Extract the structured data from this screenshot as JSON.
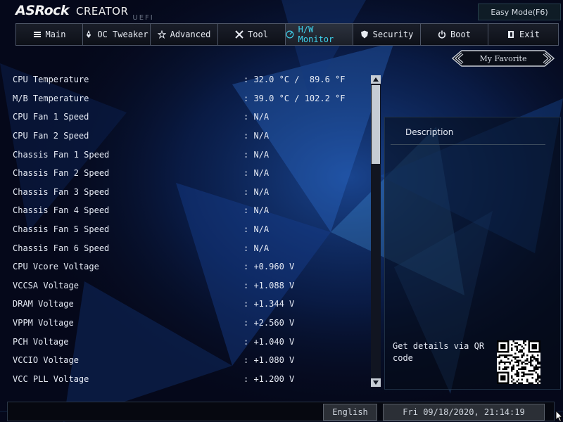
{
  "brand": {
    "logo": "ASRock",
    "line": "CREATOR",
    "uefi": "UEFI"
  },
  "easy_mode_label": "Easy Mode(F6)",
  "tabs": [
    {
      "label": "Main",
      "icon": "list-icon",
      "active": false
    },
    {
      "label": "OC Tweaker",
      "icon": "rocket-icon",
      "active": false
    },
    {
      "label": "Advanced",
      "icon": "star-icon",
      "active": false
    },
    {
      "label": "Tool",
      "icon": "tools-icon",
      "active": false
    },
    {
      "label": "H/W Monitor",
      "icon": "monitor-icon",
      "active": true
    },
    {
      "label": "Security",
      "icon": "shield-icon",
      "active": false
    },
    {
      "label": "Boot",
      "icon": "power-icon",
      "active": false
    },
    {
      "label": "Exit",
      "icon": "exit-icon",
      "active": false
    }
  ],
  "favorite_label": "My Favorite",
  "monitor": [
    {
      "label": "CPU Temperature",
      "value": ": 32.0 °C /  89.6 °F"
    },
    {
      "label": "M/B Temperature",
      "value": ": 39.0 °C / 102.2 °F"
    },
    {
      "label": "CPU Fan 1 Speed",
      "value": ": N/A"
    },
    {
      "label": "CPU Fan 2 Speed",
      "value": ": N/A"
    },
    {
      "label": "Chassis Fan 1 Speed",
      "value": ": N/A"
    },
    {
      "label": "Chassis Fan 2 Speed",
      "value": ": N/A"
    },
    {
      "label": "Chassis Fan 3 Speed",
      "value": ": N/A"
    },
    {
      "label": "Chassis Fan 4 Speed",
      "value": ": N/A"
    },
    {
      "label": "Chassis Fan 5 Speed",
      "value": ": N/A"
    },
    {
      "label": "Chassis Fan 6 Speed",
      "value": ": N/A"
    },
    {
      "label": "CPU Vcore Voltage",
      "value": ": +0.960 V"
    },
    {
      "label": "VCCSA Voltage",
      "value": ": +1.088 V"
    },
    {
      "label": "DRAM Voltage",
      "value": ": +1.344 V"
    },
    {
      "label": "VPPM Voltage",
      "value": ": +2.560 V"
    },
    {
      "label": "PCH Voltage",
      "value": ": +1.040 V"
    },
    {
      "label": "VCCIO Voltage",
      "value": ": +1.080 V"
    },
    {
      "label": "VCC PLL Voltage",
      "value": ": +1.200 V"
    }
  ],
  "description": {
    "title": "Description",
    "qr_text": "Get details via QR code"
  },
  "footer": {
    "language": "English",
    "datetime": "Fri 09/18/2020, 21:14:19"
  },
  "colors": {
    "accent": "#3fd3ee",
    "background": "#06091a",
    "text": "#e6ebf5"
  }
}
